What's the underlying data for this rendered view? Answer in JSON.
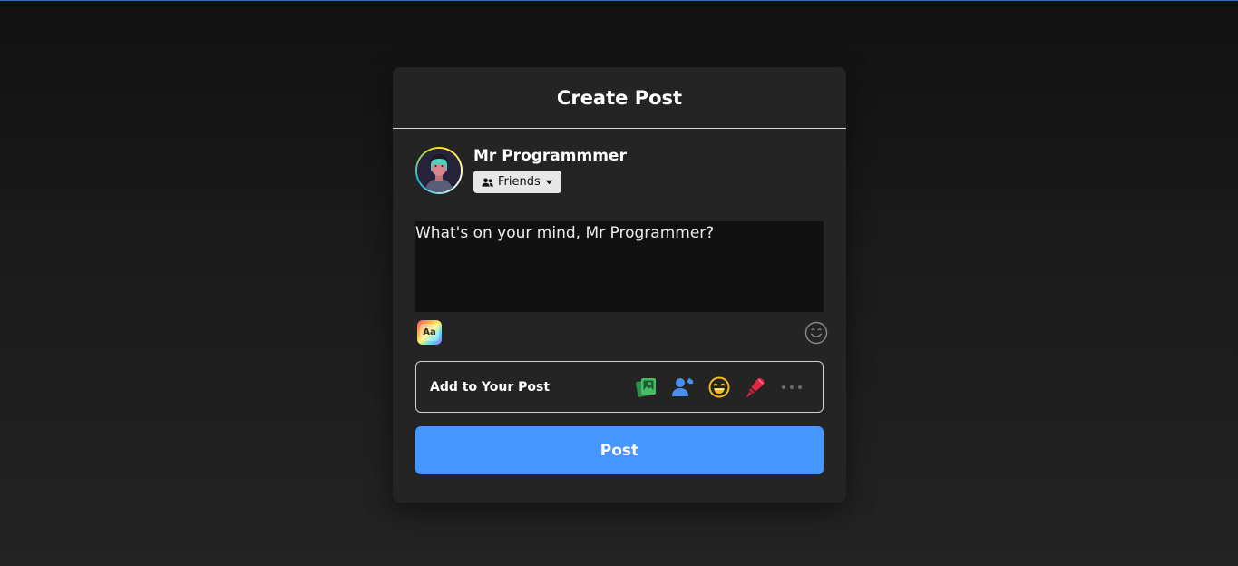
{
  "header": {
    "title": "Create Post"
  },
  "user": {
    "name": "Mr Programmmer",
    "privacy_label": "Friends"
  },
  "composer": {
    "placeholder": "What's on your mind, Mr Programmer?",
    "text_format_label": "Aa"
  },
  "add_to_post": {
    "label": "Add to Your Post",
    "icons": [
      "photo-icon",
      "tag-people-icon",
      "feeling-icon",
      "live-video-icon",
      "more-icon"
    ]
  },
  "actions": {
    "post_label": "Post"
  },
  "colors": {
    "accent": "#4596ff",
    "card_bg": "#242424",
    "photo": "#45bd62",
    "tag": "#1877f2",
    "feeling": "#f7b928",
    "live": "#e42645"
  }
}
